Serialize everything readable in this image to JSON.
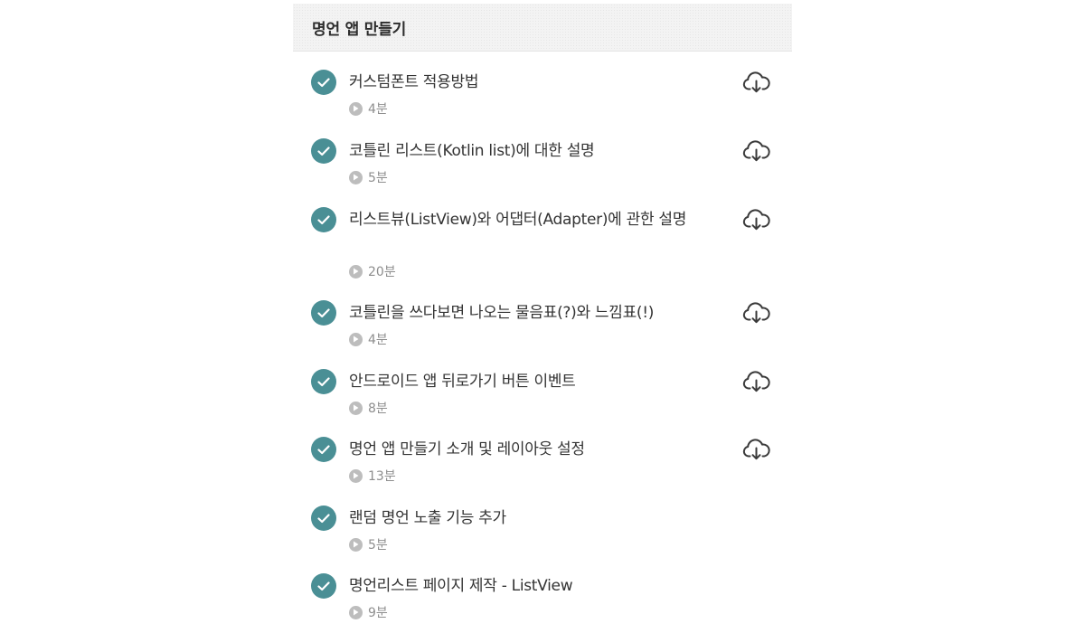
{
  "section": {
    "title": "명언 앱 만들기"
  },
  "lessons": [
    {
      "title": "커스텀폰트 적용방법",
      "duration": "4분",
      "download": true
    },
    {
      "title": "코틀린 리스트(Kotlin list)에 대한 설명",
      "duration": "5분",
      "download": true
    },
    {
      "title": "리스트뷰(ListView)와 어댑터(Adapter)에 관한 설명",
      "duration": "20분",
      "download": true
    },
    {
      "title": "코틀린을 쓰다보면 나오는 물음표(?)와 느낌표(!)",
      "duration": "4분",
      "download": true
    },
    {
      "title": "안드로이드 앱 뒤로가기 버튼 이벤트",
      "duration": "8분",
      "download": true
    },
    {
      "title": "명언 앱 만들기 소개 및 레이아웃 설정",
      "duration": "13분",
      "download": true
    },
    {
      "title": "랜덤 명언 노출 기능 추가",
      "duration": "5분",
      "download": false
    },
    {
      "title": "명언리스트 페이지 제작 - ListView",
      "duration": "9분",
      "download": false
    }
  ],
  "colors": {
    "check": "#4a8f95",
    "play": "#bdbdbd",
    "download": "#3a3a3a"
  },
  "icons": {
    "complete": "check-circle-icon",
    "duration": "play-circle-icon",
    "download": "cloud-download-icon"
  }
}
